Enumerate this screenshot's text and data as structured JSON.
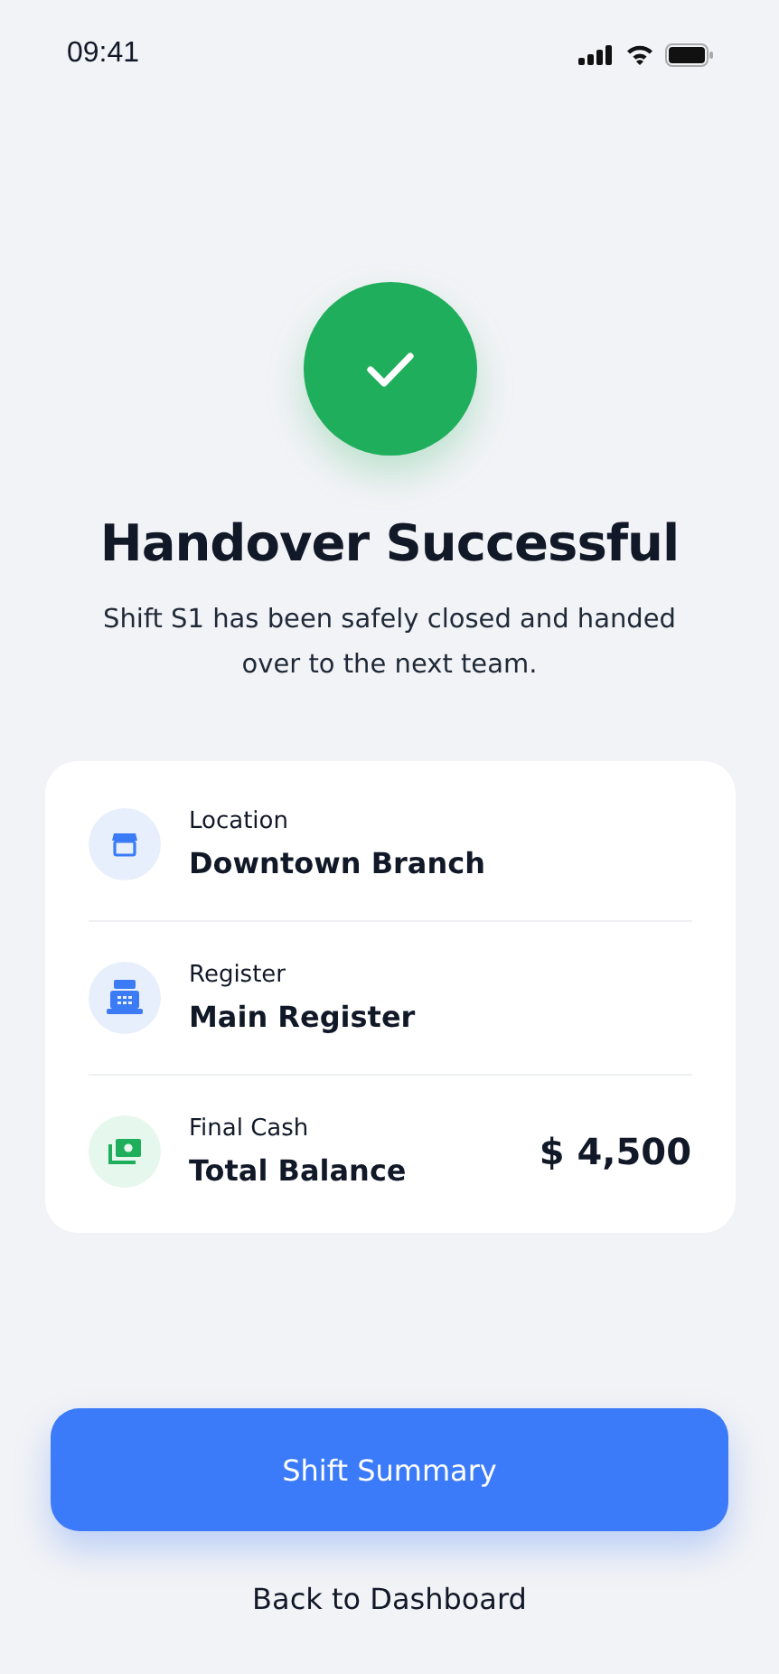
{
  "status_bar": {
    "time": "09:41"
  },
  "title": "Handover Successful",
  "message": "Shift S1 has been safely closed and handed over to the next team.",
  "details": [
    {
      "kind": "store",
      "label": "Location",
      "value": "Downtown Branch"
    },
    {
      "kind": "register",
      "label": "Register",
      "value": "Main Register"
    },
    {
      "kind": "cash",
      "label": "Final Cash",
      "value": "Total Balance",
      "amount": "$ 4,500"
    }
  ],
  "primary_button": "Shift Summary",
  "secondary_link": "Back to Dashboard"
}
